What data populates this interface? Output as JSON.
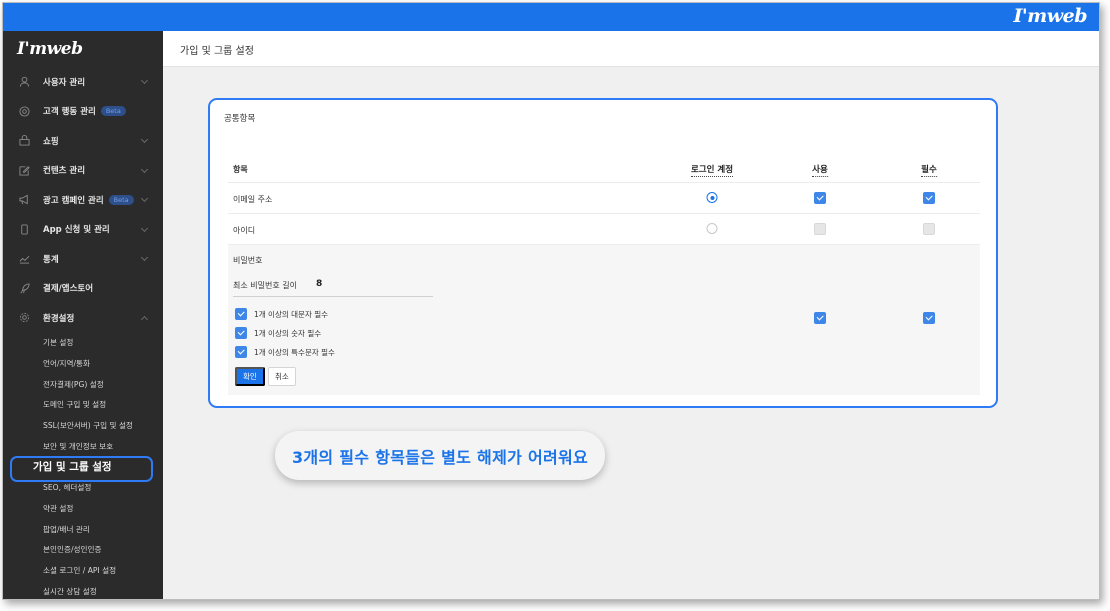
{
  "app": {
    "brand": "I'mweb"
  },
  "sidebar": {
    "logo": "I'mweb",
    "items": [
      {
        "label": "사용자 관리",
        "icon": "user-icon"
      },
      {
        "label": "고객 행동 관리",
        "icon": "target-icon",
        "badge": "Beta"
      },
      {
        "label": "쇼핑",
        "icon": "shop-icon"
      },
      {
        "label": "컨텐츠 관리",
        "icon": "edit-icon"
      },
      {
        "label": "광고 캠페인 관리",
        "icon": "megaphone-icon",
        "badge": "Beta"
      },
      {
        "label": "App 신청 및 관리",
        "icon": "phone-icon"
      },
      {
        "label": "통계",
        "icon": "chart-icon"
      },
      {
        "label": "결제/앱스토어",
        "icon": "rocket-icon"
      },
      {
        "label": "환경설정",
        "icon": "gear-icon"
      }
    ],
    "submenu": [
      "기본 설정",
      "언어/지역/통화",
      "전자결제(PG) 설정",
      "도메인 구입 및 설정",
      "SSL(보안서버) 구입 및 설정",
      "보안 및 개인정보 보호",
      "가입 및 그룹 설정",
      "SEO, 헤더설정",
      "약관 설정",
      "팝업/배너 관리",
      "본인인증/성인인증",
      "소셜 로그인 / API 설정",
      "실시간 상담 설정"
    ]
  },
  "header": {
    "title": "가입 및 그룹 설정"
  },
  "card": {
    "title": "공통항목",
    "columns": {
      "item": "항목",
      "login": "로그인 계정",
      "use": "사용",
      "required": "필수"
    },
    "rows": [
      {
        "label": "이메일 주소",
        "login": true,
        "use": true,
        "required": true
      },
      {
        "label": "아이디",
        "login": false,
        "use": false,
        "required": false
      }
    ],
    "password": {
      "label": "비밀번호",
      "min_length_label": "최소 비밀번호 길이",
      "min_length_value": "8",
      "options": [
        "1개 이상의 대문자 필수",
        "1개 이상의 숫자 필수",
        "1개 이상의 특수문자 필수"
      ],
      "use": true,
      "required": true,
      "confirm_label": "확인",
      "cancel_label": "취소"
    }
  },
  "tooltip": {
    "text": "3개의 필수 항목들은 별도 해제가 어려워요"
  },
  "colors": {
    "accent": "#1a73e8",
    "highlight": "#2f7bf5",
    "sidebar_bg": "#2b2b2b"
  }
}
